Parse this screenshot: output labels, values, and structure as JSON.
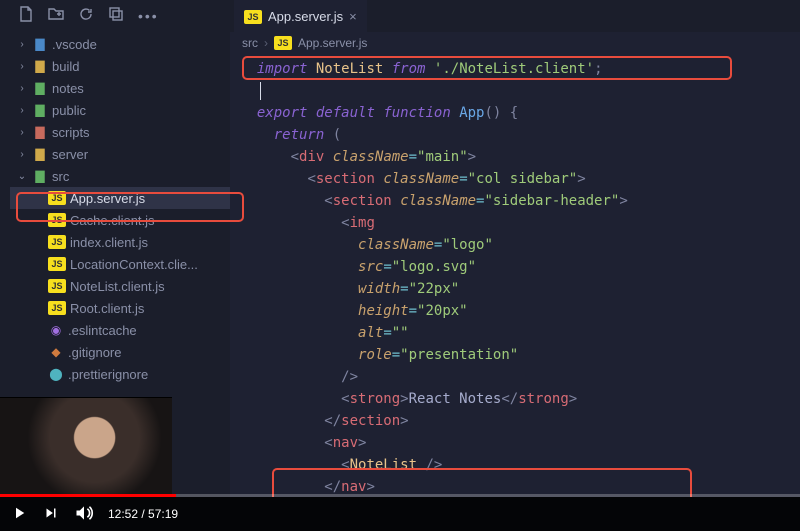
{
  "editor": {
    "tab": {
      "label": "App.server.js",
      "icon": "JS"
    },
    "breadcrumb": {
      "part1": "src",
      "part2": "App.server.js",
      "icon": "JS"
    }
  },
  "tree": {
    "items": [
      {
        "name": ".vscode",
        "kind": "folder",
        "color": "blue",
        "expanded": false,
        "depth": 0
      },
      {
        "name": "build",
        "kind": "folder",
        "color": "yellow",
        "expanded": false,
        "depth": 0
      },
      {
        "name": "notes",
        "kind": "folder",
        "color": "green",
        "expanded": false,
        "depth": 0
      },
      {
        "name": "public",
        "kind": "folder",
        "color": "green",
        "expanded": false,
        "depth": 0
      },
      {
        "name": "scripts",
        "kind": "folder",
        "color": "red",
        "expanded": false,
        "depth": 0
      },
      {
        "name": "server",
        "kind": "folder",
        "color": "yellow",
        "expanded": false,
        "depth": 0
      },
      {
        "name": "src",
        "kind": "folder",
        "color": "green",
        "expanded": true,
        "depth": 0
      },
      {
        "name": "App.server.js",
        "kind": "js",
        "depth": 1,
        "selected": true
      },
      {
        "name": "Cache.client.js",
        "kind": "js",
        "depth": 1
      },
      {
        "name": "index.client.js",
        "kind": "js",
        "depth": 1
      },
      {
        "name": "LocationContext.clie...",
        "kind": "js",
        "depth": 1
      },
      {
        "name": "NoteList.client.js",
        "kind": "js",
        "depth": 1
      },
      {
        "name": "Root.client.js",
        "kind": "js",
        "depth": 1
      },
      {
        "name": ".eslintcache",
        "kind": "dot-purple",
        "depth": 1
      },
      {
        "name": ".gitignore",
        "kind": "dot-orange",
        "depth": 1
      },
      {
        "name": ".prettierignore",
        "kind": "dot-teal",
        "depth": 1
      }
    ]
  },
  "code": {
    "lines": [
      {
        "ind": 0,
        "seg": [
          [
            "kw",
            "import"
          ],
          [
            "",
            " "
          ],
          [
            "cls",
            "NoteList"
          ],
          [
            "",
            " "
          ],
          [
            "kw",
            "from"
          ],
          [
            "",
            " "
          ],
          [
            "str",
            "'./NoteList.client'"
          ],
          [
            "punc",
            ";"
          ]
        ]
      },
      {
        "ind": 0,
        "seg": []
      },
      {
        "ind": 0,
        "seg": [
          [
            "kw",
            "export"
          ],
          [
            "",
            " "
          ],
          [
            "kw",
            "default"
          ],
          [
            "",
            " "
          ],
          [
            "kw",
            "function"
          ],
          [
            "",
            " "
          ],
          [
            "fn",
            "App"
          ],
          [
            "punc",
            "()"
          ],
          [
            "",
            " "
          ],
          [
            "punc",
            "{"
          ]
        ]
      },
      {
        "ind": 1,
        "seg": [
          [
            "kw",
            "return"
          ],
          [
            "",
            " "
          ],
          [
            "punc",
            "("
          ]
        ]
      },
      {
        "ind": 2,
        "seg": [
          [
            "punc",
            "<"
          ],
          [
            "tag",
            "div"
          ],
          [
            "",
            " "
          ],
          [
            "attr",
            "className"
          ],
          [
            "op",
            "="
          ],
          [
            "str",
            "\"main\""
          ],
          [
            "punc",
            ">"
          ]
        ]
      },
      {
        "ind": 3,
        "seg": [
          [
            "punc",
            "<"
          ],
          [
            "tag",
            "section"
          ],
          [
            "",
            " "
          ],
          [
            "attr",
            "className"
          ],
          [
            "op",
            "="
          ],
          [
            "str",
            "\"col sidebar\""
          ],
          [
            "punc",
            ">"
          ]
        ]
      },
      {
        "ind": 4,
        "seg": [
          [
            "punc",
            "<"
          ],
          [
            "tag",
            "section"
          ],
          [
            "",
            " "
          ],
          [
            "attr",
            "className"
          ],
          [
            "op",
            "="
          ],
          [
            "str",
            "\"sidebar-header\""
          ],
          [
            "punc",
            ">"
          ]
        ]
      },
      {
        "ind": 5,
        "seg": [
          [
            "punc",
            "<"
          ],
          [
            "tag",
            "img"
          ]
        ]
      },
      {
        "ind": 6,
        "seg": [
          [
            "attr",
            "className"
          ],
          [
            "op",
            "="
          ],
          [
            "str",
            "\"logo\""
          ]
        ]
      },
      {
        "ind": 6,
        "seg": [
          [
            "attr",
            "src"
          ],
          [
            "op",
            "="
          ],
          [
            "str",
            "\"logo.svg\""
          ]
        ]
      },
      {
        "ind": 6,
        "seg": [
          [
            "attr",
            "width"
          ],
          [
            "op",
            "="
          ],
          [
            "str",
            "\"22px\""
          ]
        ]
      },
      {
        "ind": 6,
        "seg": [
          [
            "attr",
            "height"
          ],
          [
            "op",
            "="
          ],
          [
            "str",
            "\"20px\""
          ]
        ]
      },
      {
        "ind": 6,
        "seg": [
          [
            "attr",
            "alt"
          ],
          [
            "op",
            "="
          ],
          [
            "str",
            "\"\""
          ]
        ]
      },
      {
        "ind": 6,
        "seg": [
          [
            "attr",
            "role"
          ],
          [
            "op",
            "="
          ],
          [
            "str",
            "\"presentation\""
          ]
        ]
      },
      {
        "ind": 5,
        "seg": [
          [
            "punc",
            "/>"
          ]
        ]
      },
      {
        "ind": 5,
        "seg": [
          [
            "punc",
            "<"
          ],
          [
            "tag",
            "strong"
          ],
          [
            "punc",
            ">"
          ],
          [
            "",
            "React Notes"
          ],
          [
            "punc",
            "</"
          ],
          [
            "tag",
            "strong"
          ],
          [
            "punc",
            ">"
          ]
        ]
      },
      {
        "ind": 4,
        "seg": [
          [
            "punc",
            "</"
          ],
          [
            "tag",
            "section"
          ],
          [
            "punc",
            ">"
          ]
        ]
      },
      {
        "ind": 4,
        "seg": [
          [
            "punc",
            "<"
          ],
          [
            "tag",
            "nav"
          ],
          [
            "punc",
            ">"
          ]
        ]
      },
      {
        "ind": 5,
        "seg": [
          [
            "punc",
            "<"
          ],
          [
            "cls",
            "NoteList"
          ],
          [
            "",
            " "
          ],
          [
            "punc",
            "/>"
          ]
        ]
      },
      {
        "ind": 4,
        "seg": [
          [
            "punc",
            "</"
          ],
          [
            "tag",
            "nav"
          ],
          [
            "punc",
            ">"
          ]
        ]
      }
    ]
  },
  "video": {
    "current": "12:52",
    "duration": "57:19"
  }
}
